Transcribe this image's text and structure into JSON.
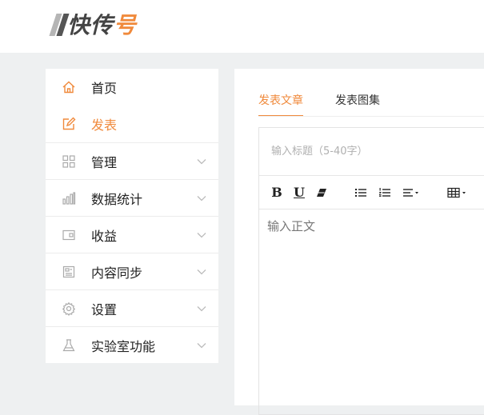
{
  "logo": {
    "prefix": "快传",
    "accent": "号"
  },
  "sidebar": {
    "items": [
      {
        "label": "首页",
        "icon": "home-icon",
        "active": false,
        "expandable": false
      },
      {
        "label": "发表",
        "icon": "edit-icon",
        "active": true,
        "expandable": false
      },
      {
        "label": "管理",
        "icon": "grid-icon",
        "active": false,
        "expandable": true
      },
      {
        "label": "数据统计",
        "icon": "bar-chart-icon",
        "active": false,
        "expandable": true
      },
      {
        "label": "收益",
        "icon": "wallet-icon",
        "active": false,
        "expandable": true
      },
      {
        "label": "内容同步",
        "icon": "document-icon",
        "active": false,
        "expandable": true
      },
      {
        "label": "设置",
        "icon": "gear-icon",
        "active": false,
        "expandable": true
      },
      {
        "label": "实验室功能",
        "icon": "flask-icon",
        "active": false,
        "expandable": true
      }
    ]
  },
  "tabs": [
    {
      "label": "发表文章",
      "active": true
    },
    {
      "label": "发表图集",
      "active": false
    }
  ],
  "editor": {
    "title_placeholder": "输入标题（5-40字）",
    "body_placeholder": "输入正文"
  },
  "colors": {
    "accent": "#f08a3c",
    "text": "#222222",
    "icon": "#aaaaaa"
  }
}
